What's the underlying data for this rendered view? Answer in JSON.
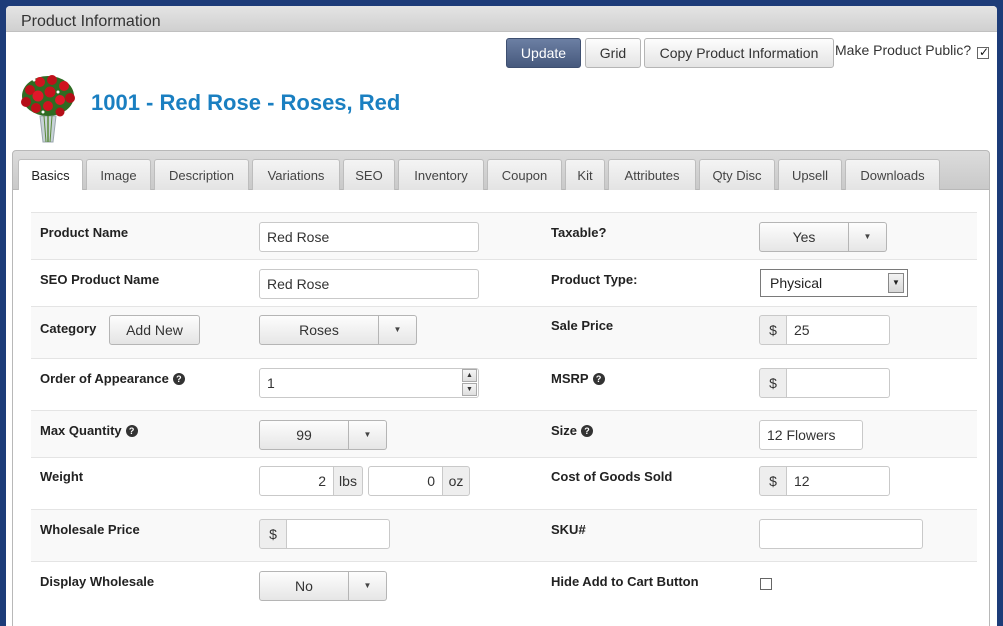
{
  "panel": {
    "title": "Product Information"
  },
  "toolbar": {
    "update_label": "Update",
    "grid_label": "Grid",
    "copy_label": "Copy Product Information",
    "public_label": "Make Product Public?",
    "public_checked": true
  },
  "product": {
    "heading": "1001 - Red Rose - Roses, Red"
  },
  "tabs": [
    "Basics",
    "Image",
    "Description",
    "Variations",
    "SEO",
    "Inventory",
    "Coupon",
    "Kit",
    "Attributes",
    "Qty Disc",
    "Upsell",
    "Downloads"
  ],
  "active_tab": "Basics",
  "form": {
    "product_name": {
      "label": "Product Name",
      "value": "Red Rose"
    },
    "seo_product_name": {
      "label": "SEO Product Name",
      "value": "Red Rose"
    },
    "category": {
      "label": "Category",
      "add_new_label": "Add New",
      "value": "Roses"
    },
    "order_of_appearance": {
      "label": "Order of Appearance",
      "value": "1"
    },
    "max_quantity": {
      "label": "Max Quantity",
      "value": "99"
    },
    "weight": {
      "label": "Weight",
      "lbs_value": "2",
      "lbs_unit": "lbs",
      "oz_value": "0",
      "oz_unit": "oz"
    },
    "wholesale_price": {
      "label": "Wholesale Price",
      "currency": "$",
      "value": ""
    },
    "display_wholesale": {
      "label": "Display Wholesale",
      "value": "No"
    },
    "taxable": {
      "label": "Taxable?",
      "value": "Yes"
    },
    "product_type": {
      "label": "Product Type:",
      "value": "Physical"
    },
    "sale_price": {
      "label": "Sale Price",
      "currency": "$",
      "value": "25"
    },
    "msrp": {
      "label": "MSRP",
      "currency": "$",
      "value": ""
    },
    "size": {
      "label": "Size",
      "value": "12 Flowers"
    },
    "cost_of_goods": {
      "label": "Cost of Goods Sold",
      "currency": "$",
      "value": "12"
    },
    "sku": {
      "label": "SKU#",
      "value": ""
    },
    "hide_add_to_cart": {
      "label": "Hide Add to Cart Button",
      "checked": false
    }
  },
  "help_glyph": "?",
  "icons": {
    "caret": "▼",
    "spin_up": "▲",
    "spin_down": "▼",
    "check": "✓",
    "product_image": "red-roses-bouquet-icon"
  },
  "colors": {
    "background": "#1d3c79",
    "title_blue": "#1a7fc1",
    "primary_button": "#56698d"
  }
}
